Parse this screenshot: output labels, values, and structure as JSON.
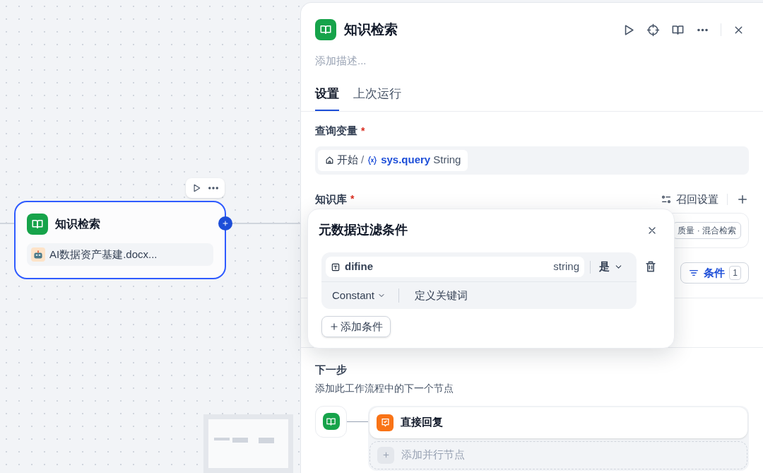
{
  "canvas": {
    "node": {
      "title": "知识检索",
      "dataset": "AI数据资产基建.docx...",
      "selected": true
    }
  },
  "panel": {
    "title": "知识检索",
    "description_placeholder": "添加描述...",
    "tabs": [
      {
        "label": "设置",
        "selected": true
      },
      {
        "label": "上次运行",
        "selected": false
      }
    ],
    "query_variable": {
      "label": "查询变量",
      "required_mark": "*",
      "node": "开始",
      "separator": "/",
      "variable": "sys.query",
      "type": "String"
    },
    "knowledge": {
      "label": "知识库",
      "required_mark": "*",
      "recall_settings": "召回设置",
      "dataset_tag": "质量 · 混合检索",
      "condition_button": "条件",
      "condition_count": "1"
    },
    "next_step": {
      "title": "下一步",
      "description": "添加此工作流程中的下一个节点",
      "nodes": [
        {
          "title": "直接回复"
        }
      ],
      "add_parallel": "添加并行节点"
    }
  },
  "filter_popup": {
    "title": "元数据过滤条件",
    "conditions": [
      {
        "field": "difine",
        "type": "string",
        "operator": "是",
        "value_kind": "Constant",
        "value": "定义关键词"
      }
    ],
    "add_button": "添加条件"
  }
}
